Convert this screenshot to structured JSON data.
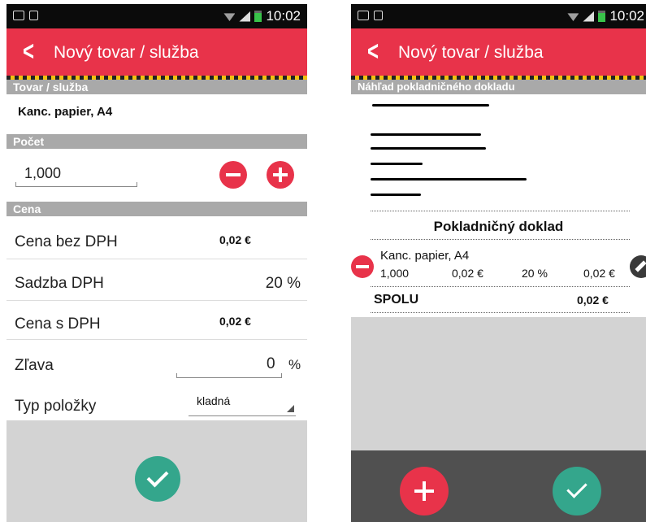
{
  "status_bar": {
    "time": "10:02"
  },
  "left_screen": {
    "title": "Nový tovar / služba",
    "sections": {
      "item": "Tovar / služba",
      "count": "Počet",
      "price": "Cena"
    },
    "item_name": "Kanc. papier, A4",
    "quantity": "1,000",
    "fields": {
      "price_no_vat_label": "Cena bez DPH",
      "price_no_vat_value": "0,02 €",
      "vat_rate_label": "Sadzba DPH",
      "vat_rate_value": "20 %",
      "price_with_vat_label": "Cena s DPH",
      "price_with_vat_value": "0,02 €",
      "discount_label": "Zľava",
      "discount_value": "0",
      "discount_unit": "%",
      "item_type_label": "Typ položky",
      "item_type_value": "kladná"
    },
    "icons": {
      "back": "chevron-left-icon",
      "minus": "minus-icon",
      "plus": "plus-icon",
      "confirm": "check-icon"
    }
  },
  "right_screen": {
    "title": "Nový tovar / služba",
    "section": "Náhľad pokladničného dokladu",
    "receipt_title": "Pokladničný doklad",
    "line_item": {
      "name": "Kanc. papier, A4",
      "quantity": "1,000",
      "unit_price": "0,02 €",
      "vat": "20 %",
      "total": "0,02 €"
    },
    "total_label": "SPOLU",
    "total_value": "0,02 €",
    "icons": {
      "remove": "minus-icon",
      "edit": "pencil-icon",
      "add": "plus-icon",
      "confirm": "check-icon"
    }
  },
  "colors": {
    "accent": "#e8334a",
    "confirm": "#34a68c",
    "section": "#a9a9a9",
    "bottom_gray": "#d3d3d3",
    "bottom_dark": "#505050"
  }
}
